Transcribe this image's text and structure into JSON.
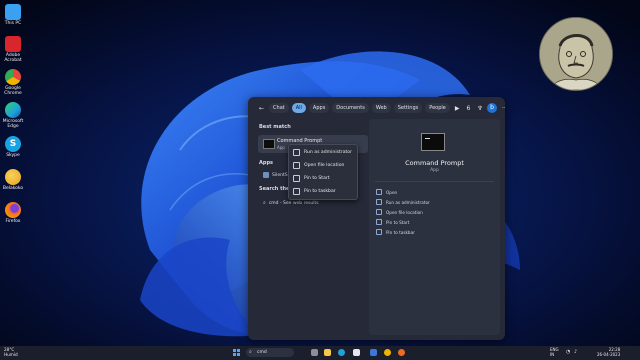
{
  "desktop": {
    "icons": [
      {
        "label": "This PC",
        "name": "desktop-icon-this-pc",
        "color": "#3aa0f2"
      },
      {
        "label": "Adobe\nAcrobat",
        "name": "desktop-icon-adobe-acrobat",
        "color": "#d8262c"
      },
      {
        "label": "Google\nChrome",
        "name": "desktop-icon-google-chrome",
        "color": "#f0b400"
      },
      {
        "label": "Microsoft\nEdge",
        "name": "desktop-icon-microsoft-edge",
        "color": "#1fa2d9"
      },
      {
        "label": "Skype",
        "name": "desktop-icon-skype",
        "color": "#1aa3e3"
      },
      {
        "label": "Belakoko",
        "name": "desktop-icon-belakoko",
        "color": "#e8a31f"
      },
      {
        "label": "Firefox",
        "name": "desktop-icon-firefox",
        "color": "#f26b21"
      }
    ]
  },
  "search": {
    "tabs": [
      {
        "label": "Chat",
        "active": false
      },
      {
        "label": "All",
        "active": true
      },
      {
        "label": "Apps",
        "active": false
      },
      {
        "label": "Documents",
        "active": false
      },
      {
        "label": "Web",
        "active": false
      },
      {
        "label": "Settings",
        "active": false
      },
      {
        "label": "People",
        "active": false
      }
    ],
    "badge_count": "6",
    "best_match_heading": "Best match",
    "best_match": {
      "title": "Command Prompt",
      "subtitle": "App"
    },
    "apps_heading": "Apps",
    "apps_item": "SilentSe",
    "search_web_heading": "Search the w",
    "web_result": "cmd - See web results"
  },
  "context_menu": {
    "items": [
      "Run as administrator",
      "Open file location",
      "Pin to Start",
      "Pin to taskbar"
    ]
  },
  "preview": {
    "title": "Command Prompt",
    "subtitle": "App",
    "actions": [
      "Open",
      "Run as administrator",
      "Open file location",
      "Pin to Start",
      "Pin to taskbar"
    ]
  },
  "taskbar": {
    "weather_temp": "28°C",
    "weather_desc": "Humid",
    "search_text": "cmd",
    "lang_top": "ENG",
    "lang_bottom": "IN",
    "time": "22:28",
    "date": "26-04-2023"
  },
  "colors": {
    "accent": "#6da9ea",
    "wallpaper_blue": "#1e4fd6"
  }
}
